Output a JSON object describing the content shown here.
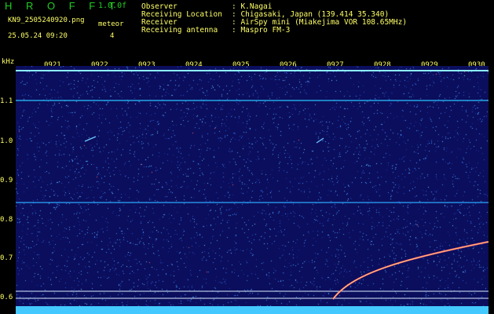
{
  "app": {
    "title": "H R O F F T",
    "version": "1.0.0f"
  },
  "file": {
    "name": "KN9_2505240920.png",
    "mode": "meteor",
    "datetime": "25.05.24 09:20",
    "count": "4"
  },
  "station": [
    {
      "label": "Observer",
      "value": ": K.Nagai"
    },
    {
      "label": "Receiving Location",
      "value": ": Chigasaki, Japan (139.414 35.340)"
    },
    {
      "label": "Receiver",
      "value": ": AirSpy mini (Miakejima VOR 108.65MHz)"
    },
    {
      "label": "Receiving antenna",
      "value": ": Maspro FM-3"
    }
  ],
  "axis": {
    "y_unit": "kHz",
    "y_ticks": [
      "1.1",
      "1.0",
      "0.9",
      "0.8",
      "0.7",
      "0.6"
    ],
    "time_ticks": [
      "0921",
      "0922",
      "0923",
      "0924",
      "0925",
      "0926",
      "0927",
      "0928",
      "0929",
      "0930"
    ]
  },
  "colors": {
    "background": "#0b0e5c",
    "label": "#ffff66",
    "title": "#22cc22",
    "noise": "#3a8cff",
    "echo": "#ff5577"
  }
}
